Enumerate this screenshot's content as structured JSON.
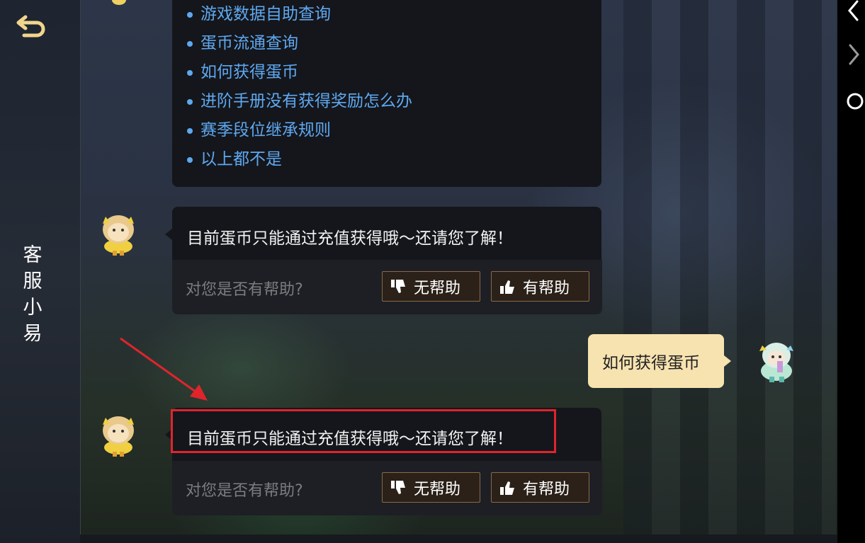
{
  "sidebar": {
    "back_icon": "back-arrow-icon",
    "title": "客服小易"
  },
  "menu": {
    "items": [
      {
        "label": "游戏数据自助查询"
      },
      {
        "label": "蛋币流通查询"
      },
      {
        "label": "如何获得蛋币"
      },
      {
        "label": "进阶手册没有获得奖励怎么办"
      },
      {
        "label": "赛季段位继承规则"
      },
      {
        "label": "以上都不是"
      }
    ]
  },
  "messages": [
    {
      "sender": "bot",
      "text": "目前蛋币只能通过充值获得哦～还请您了解！",
      "feedback_question": "对您是否有帮助?",
      "not_helpful_label": "无帮助",
      "helpful_label": "有帮助"
    },
    {
      "sender": "user",
      "text": "如何获得蛋币"
    },
    {
      "sender": "bot",
      "text": "目前蛋币只能通过充值获得哦～还请您了解！",
      "feedback_question": "对您是否有帮助?",
      "not_helpful_label": "无帮助",
      "helpful_label": "有帮助"
    }
  ],
  "colors": {
    "link_blue": "#5fa8f0",
    "bubble_dark": "#14161b",
    "user_bubble": "#f7e3b0",
    "button_border": "#8a6a48",
    "highlight_red": "#e0242c"
  },
  "system_bar": {
    "icons": [
      "chevron-left-icon",
      "chevron-right-icon",
      "circle-icon"
    ]
  }
}
